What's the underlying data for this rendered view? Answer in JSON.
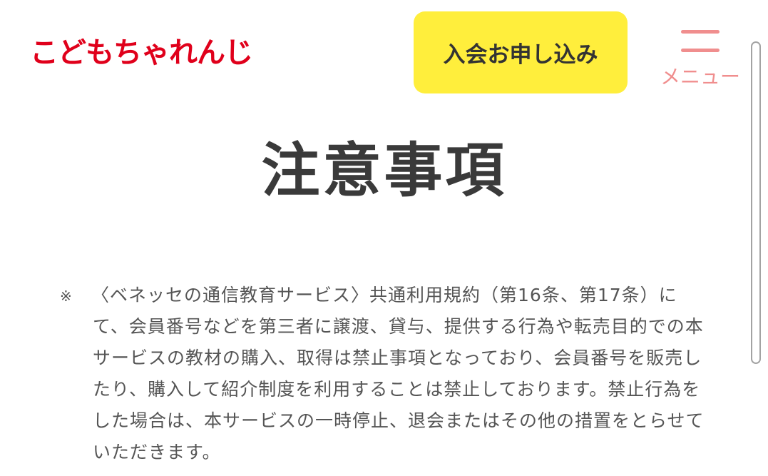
{
  "colors": {
    "logo": "#e0001b",
    "cta_bg": "#ffee3c",
    "cta_text": "#333333",
    "menu": "#f08e8e",
    "title": "#3a3a3a",
    "body_text": "#555555",
    "scrollbar": "#a3a3a3"
  },
  "header": {
    "logo_text": "こどもちゃれんじ",
    "cta_label": "入会お申し込み",
    "menu_label": "メニュー",
    "menu_icon": "hamburger-icon"
  },
  "main": {
    "title": "注意事項",
    "notes": [
      {
        "mark": "※",
        "text": "〈ベネッセの通信教育サービス〉共通利用規約（第16条、第17条）にて、会員番号などを第三者に譲渡、貸与、提供する行為や転売目的での本サービスの教材の購入、取得は禁止事項となっており、会員番号を販売したり、購入して紹介制度を利用することは禁止しております。禁止行為をした場合は、本サービスの一時停止、退会またはその他の措置をとらせていただきます。"
      }
    ]
  }
}
